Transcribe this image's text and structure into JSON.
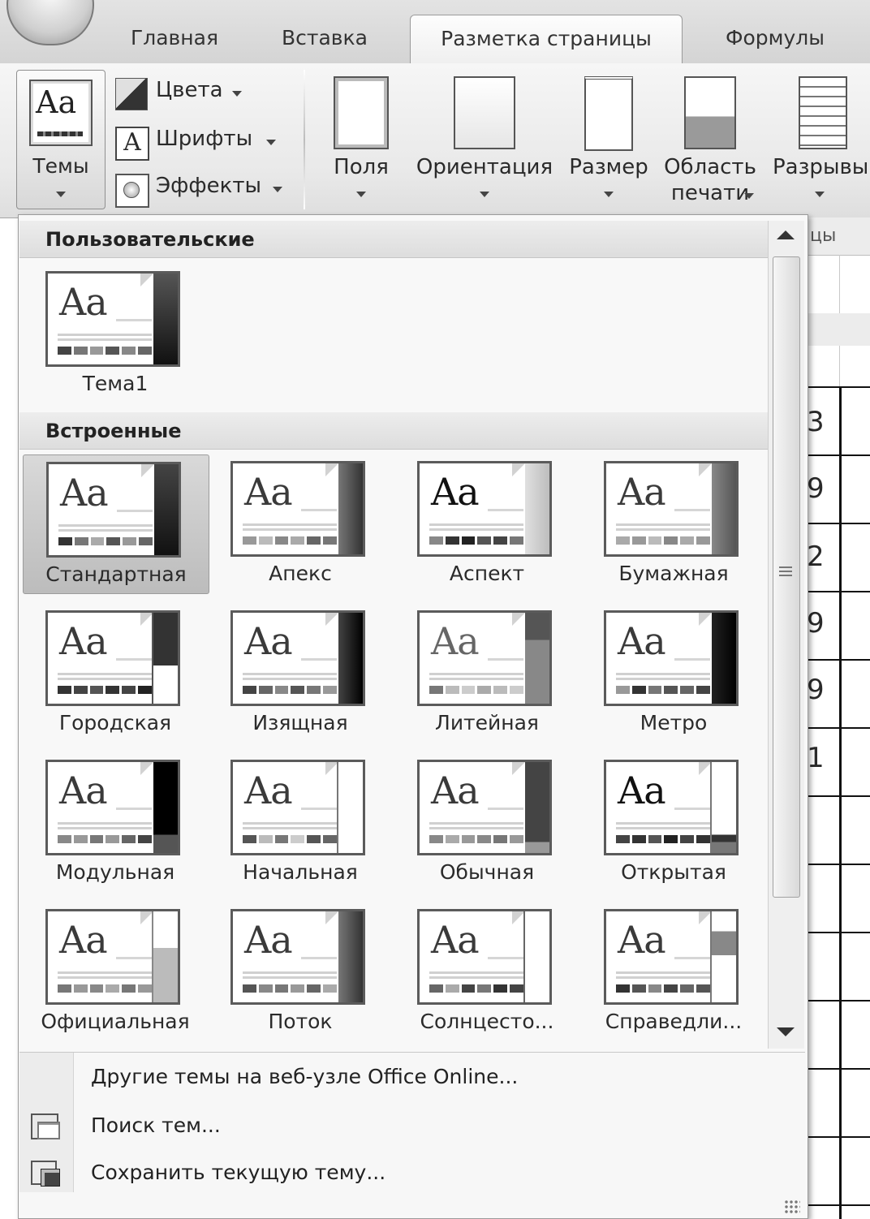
{
  "ribbon_tabs": [
    {
      "label": "Главная",
      "active": false
    },
    {
      "label": "Вставка",
      "active": false
    },
    {
      "label": "Разметка страницы",
      "active": true
    },
    {
      "label": "Формулы",
      "active": false
    }
  ],
  "theme_group": {
    "themes_label": "Темы",
    "colors_label": "Цвета",
    "fonts_label": "Шрифты",
    "effects_label": "Эффекты"
  },
  "page_setup": {
    "margins": "Поля",
    "orientation": "Ориентация",
    "size": "Размер",
    "print_area_line1": "Область",
    "print_area_line2": "печати",
    "breaks": "Разрывы",
    "group_label_fragment": "цы"
  },
  "gallery": {
    "custom_header": "Пользовательские",
    "custom_themes": [
      {
        "name": "Тема1",
        "icon": "theme-thumb",
        "side_color": "#2b2b2b"
      }
    ],
    "builtin_header": "Встроенные",
    "builtin_themes": [
      {
        "name": "Стандартная",
        "selected": true,
        "side_color": "#222222"
      },
      {
        "name": "Апекс",
        "side_color": "#555555"
      },
      {
        "name": "Аспект",
        "side_color": "#b8b8b8"
      },
      {
        "name": "Бумажная",
        "side_color": "#6c6c6c"
      },
      {
        "name": "Городская",
        "side_color": "#2f2f2f"
      },
      {
        "name": "Изящная",
        "side_color": "#1c1c1c"
      },
      {
        "name": "Литейная",
        "side_color": "#707070"
      },
      {
        "name": "Метро",
        "side_color": "#0d0d0d"
      },
      {
        "name": "Модульная",
        "side_color": "#050505"
      },
      {
        "name": "Начальная",
        "side_color": "#ffffff"
      },
      {
        "name": "Обычная",
        "side_color": "#4a4a4a"
      },
      {
        "name": "Открытая",
        "side_color": "#ffffff"
      },
      {
        "name": "Официальная",
        "side_color": "#bdbdbd"
      },
      {
        "name": "Поток",
        "side_color": "#4d4d4d"
      },
      {
        "name": "Солнцесто...",
        "side_color": "#ffffff"
      },
      {
        "name": "Справедли...",
        "side_color": "#8a8a8a"
      }
    ],
    "thumb_text": "Aa"
  },
  "menu": {
    "more_online": "Другие темы на веб-узле Office Online...",
    "browse": "Поиск тем...",
    "save_current": "Сохранить текущую тему..."
  },
  "sheet_digits": [
    "3",
    "9",
    "2",
    "9",
    "9",
    "1"
  ]
}
